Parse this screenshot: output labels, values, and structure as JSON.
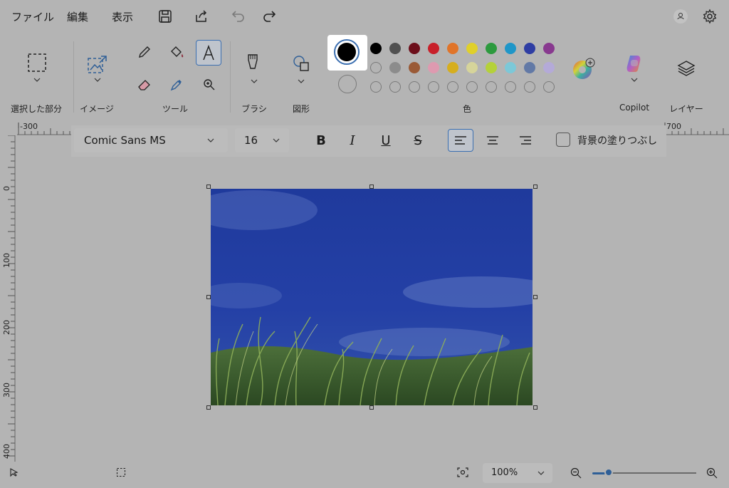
{
  "menu": {
    "file": "ファイル",
    "edit": "編集",
    "view": "表示"
  },
  "ribbon": {
    "selection_label": "選択した部分",
    "image_label": "イメージ",
    "tools_label": "ツール",
    "brush_label": "ブラシ",
    "shapes_label": "図形",
    "colors_label": "色",
    "copilot_label": "Copilot",
    "layers_label": "レイヤー",
    "palette_row1": [
      "#000000",
      "#505050",
      "#6d0f1b",
      "#c8202a",
      "#e07429",
      "#e0d02a",
      "#2c9a3e",
      "#1f96c8",
      "#2e3da3",
      "#88398f"
    ],
    "palette_row2": [
      "empty",
      "#8c8c8c",
      "#9a5a36",
      "#de9ab0",
      "#d6ae1e",
      "#d6d49a",
      "#b5d13a",
      "#7cc8d8",
      "#6279a6",
      "#b4aad8"
    ],
    "primary_color": "#000000",
    "accent_color": "#3b6fb1"
  },
  "textbar": {
    "font": "Comic Sans MS",
    "size": "16",
    "bold": "B",
    "italic": "I",
    "underline": "U",
    "strike": "S",
    "fill_label": "背景の塗りつぶし"
  },
  "ruler": {
    "h_left": "-300",
    "h_right": "700",
    "v_labels": [
      "0",
      "100",
      "200",
      "300",
      "400"
    ]
  },
  "status": {
    "zoom": "100%"
  }
}
